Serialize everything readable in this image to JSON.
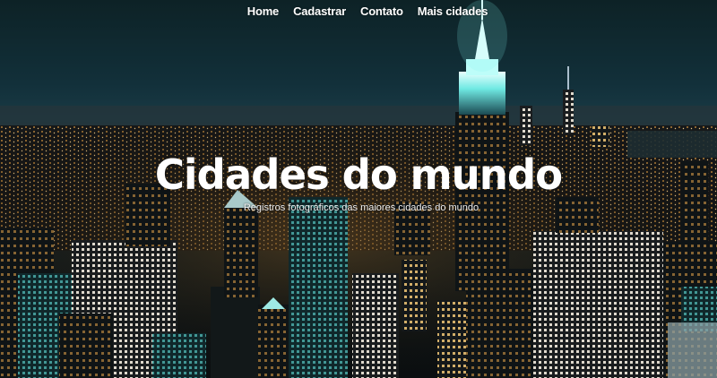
{
  "nav": {
    "items": [
      {
        "label": "Home"
      },
      {
        "label": "Cadastrar"
      },
      {
        "label": "Contato"
      },
      {
        "label": "Mais cidades"
      }
    ]
  },
  "hero": {
    "title": "Cidades do mundo",
    "subtitle": "Registros fotográficos das maiores cidades do mundo",
    "background_image": "night-city-skyline-photo",
    "colors": {
      "sky": "#0f2a30",
      "city_lights": "#f0a540",
      "spire_glow": "#a9fbf6"
    }
  }
}
